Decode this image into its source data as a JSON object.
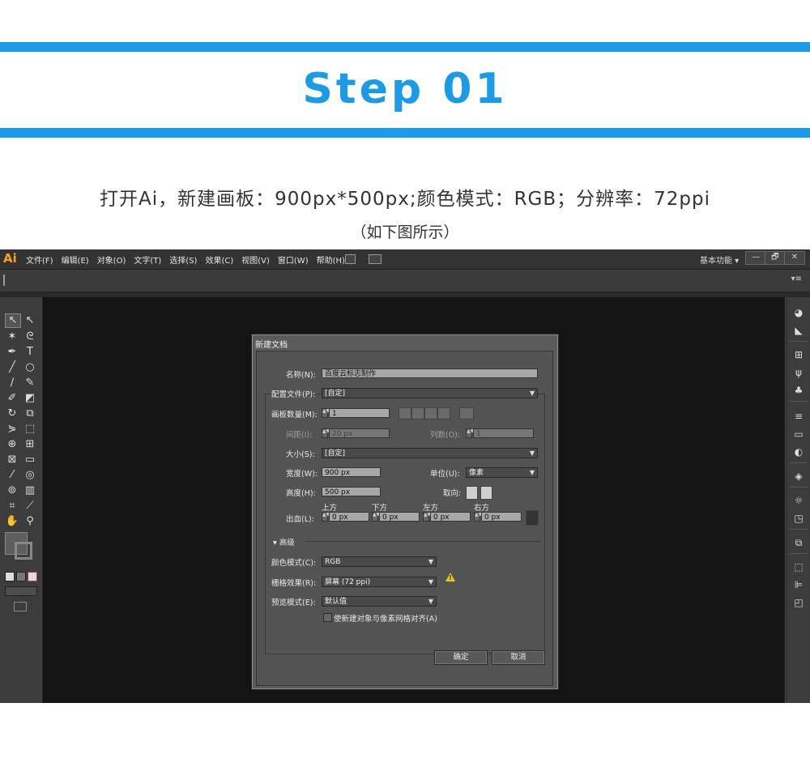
{
  "header": {
    "step": "Step 01",
    "description": "打开Ai，新建画板：900px*500px;颜色模式：RGB；分辨率：72ppi",
    "note": "（如下图所示）"
  },
  "app": {
    "logo": "Ai",
    "menus": [
      "文件(F)",
      "编辑(E)",
      "对象(O)",
      "文字(T)",
      "选择(S)",
      "效果(C)",
      "视图(V)",
      "窗口(W)",
      "帮助(H)"
    ],
    "workspace": "基本功能 ▾",
    "window_buttons": [
      "—",
      "🗗",
      "✕"
    ],
    "colors": {
      "accent": "#1a9be8",
      "logo": "#f7a21b",
      "warning": "#f2c40f"
    }
  },
  "dialog": {
    "title": "新建文档",
    "name_label": "名称(N):",
    "name_value": "百度云标志制作",
    "profile_label": "配置文件(P):",
    "profile_value": "[自定]",
    "artboards_label": "画板数量(M):",
    "artboards_value": "1",
    "spacing_label": "间距(I):",
    "spacing_value": "20 px",
    "columns_label": "列数(O):",
    "columns_value": "1",
    "size_label": "大小(S):",
    "size_value": "[自定]",
    "width_label": "宽度(W):",
    "width_value": "900 px",
    "units_label": "单位(U):",
    "units_value": "像素",
    "height_label": "高度(H):",
    "height_value": "500 px",
    "orientation_label": "取向:",
    "bleed_label": "出血(L):",
    "bleed": [
      {
        "label": "上方",
        "value": "0 px"
      },
      {
        "label": "下方",
        "value": "0 px"
      },
      {
        "label": "左方",
        "value": "0 px"
      },
      {
        "label": "右方",
        "value": "0 px"
      }
    ],
    "advanced_label": "▾ 高级",
    "color_mode_label": "颜色模式(C):",
    "color_mode_value": "RGB",
    "raster_label": "栅格效果(R):",
    "raster_value": "屏幕 (72 ppi)",
    "preview_label": "预览模式(E):",
    "preview_value": "默认值",
    "align_checkbox_label": "使新建对象与像素网格对齐(A)",
    "ok_label": "确定",
    "cancel_label": "取消"
  }
}
